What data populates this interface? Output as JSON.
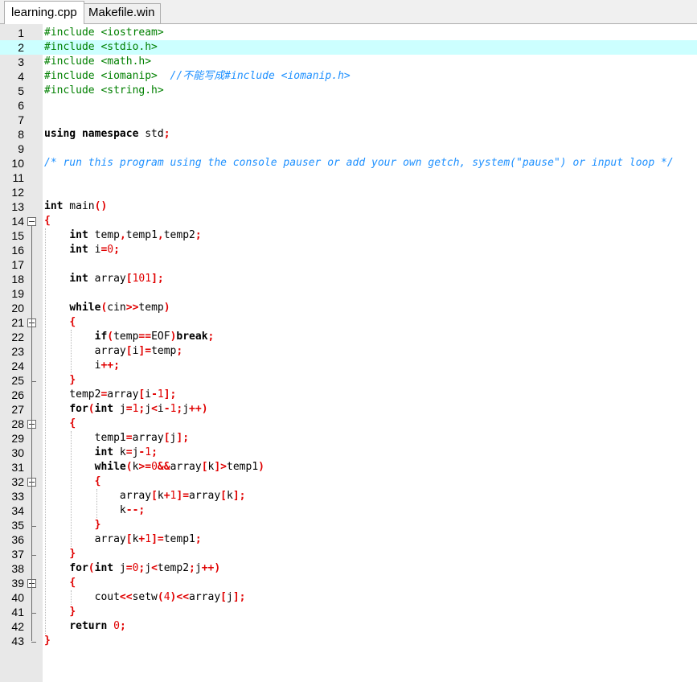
{
  "tabs": [
    "learning.cpp",
    "Makefile.win"
  ],
  "active_tab": 0,
  "highlighted_line": 2,
  "fold_markers": [
    14,
    21,
    28,
    32,
    39
  ],
  "fold_ends": [
    25,
    35,
    37,
    41,
    43
  ],
  "lines": [
    [
      [
        "pp",
        "#include <iostream>"
      ]
    ],
    [
      [
        "pp",
        "#include <stdio.h>"
      ]
    ],
    [
      [
        "pp",
        "#include <math.h>"
      ]
    ],
    [
      [
        "pp",
        "#include <iomanip>"
      ],
      [
        "t",
        "  "
      ],
      [
        "cm",
        "//不能写成#include <iomanip.h>"
      ]
    ],
    [
      [
        "pp",
        "#include <string.h>"
      ]
    ],
    [],
    [],
    [
      [
        "kw",
        "using namespace"
      ],
      [
        "t",
        " std"
      ],
      [
        "sym",
        ";"
      ]
    ],
    [],
    [
      [
        "cm",
        "/* run this program using the console pauser or add your own getch, system(\"pause\") or input loop */"
      ]
    ],
    [],
    [],
    [
      [
        "kw",
        "int"
      ],
      [
        "t",
        " main"
      ],
      [
        "sym",
        "()"
      ]
    ],
    [
      [
        "sym",
        "{"
      ]
    ],
    [
      [
        "t",
        "    "
      ],
      [
        "kw",
        "int"
      ],
      [
        "t",
        " temp"
      ],
      [
        "sym",
        ","
      ],
      [
        "t",
        "temp1"
      ],
      [
        "sym",
        ","
      ],
      [
        "t",
        "temp2"
      ],
      [
        "sym",
        ";"
      ]
    ],
    [
      [
        "t",
        "    "
      ],
      [
        "kw",
        "int"
      ],
      [
        "t",
        " i"
      ],
      [
        "sym",
        "="
      ],
      [
        "num",
        "0"
      ],
      [
        "sym",
        ";"
      ]
    ],
    [],
    [
      [
        "t",
        "    "
      ],
      [
        "kw",
        "int"
      ],
      [
        "t",
        " array"
      ],
      [
        "sym",
        "["
      ],
      [
        "num",
        "101"
      ],
      [
        "sym",
        "];"
      ]
    ],
    [],
    [
      [
        "t",
        "    "
      ],
      [
        "kw",
        "while"
      ],
      [
        "sym",
        "("
      ],
      [
        "t",
        "cin"
      ],
      [
        "sym",
        ">>"
      ],
      [
        "t",
        "temp"
      ],
      [
        "sym",
        ")"
      ]
    ],
    [
      [
        "t",
        "    "
      ],
      [
        "sym",
        "{"
      ]
    ],
    [
      [
        "t",
        "        "
      ],
      [
        "kw",
        "if"
      ],
      [
        "sym",
        "("
      ],
      [
        "t",
        "temp"
      ],
      [
        "sym",
        "=="
      ],
      [
        "t",
        "EOF"
      ],
      [
        "sym",
        ")"
      ],
      [
        "kw",
        "break"
      ],
      [
        "sym",
        ";"
      ]
    ],
    [
      [
        "t",
        "        array"
      ],
      [
        "sym",
        "["
      ],
      [
        "t",
        "i"
      ],
      [
        "sym",
        "]="
      ],
      [
        "t",
        "temp"
      ],
      [
        "sym",
        ";"
      ]
    ],
    [
      [
        "t",
        "        i"
      ],
      [
        "sym",
        "++;"
      ]
    ],
    [
      [
        "t",
        "    "
      ],
      [
        "sym",
        "}"
      ]
    ],
    [
      [
        "t",
        "    temp2"
      ],
      [
        "sym",
        "="
      ],
      [
        "t",
        "array"
      ],
      [
        "sym",
        "["
      ],
      [
        "t",
        "i"
      ],
      [
        "sym",
        "-"
      ],
      [
        "num",
        "1"
      ],
      [
        "sym",
        "];"
      ]
    ],
    [
      [
        "t",
        "    "
      ],
      [
        "kw",
        "for"
      ],
      [
        "sym",
        "("
      ],
      [
        "kw",
        "int"
      ],
      [
        "t",
        " j"
      ],
      [
        "sym",
        "="
      ],
      [
        "num",
        "1"
      ],
      [
        "sym",
        ";"
      ],
      [
        "t",
        "j"
      ],
      [
        "sym",
        "<"
      ],
      [
        "t",
        "i"
      ],
      [
        "sym",
        "-"
      ],
      [
        "num",
        "1"
      ],
      [
        "sym",
        ";"
      ],
      [
        "t",
        "j"
      ],
      [
        "sym",
        "++)"
      ]
    ],
    [
      [
        "t",
        "    "
      ],
      [
        "sym",
        "{"
      ]
    ],
    [
      [
        "t",
        "        temp1"
      ],
      [
        "sym",
        "="
      ],
      [
        "t",
        "array"
      ],
      [
        "sym",
        "["
      ],
      [
        "t",
        "j"
      ],
      [
        "sym",
        "];"
      ]
    ],
    [
      [
        "t",
        "        "
      ],
      [
        "kw",
        "int"
      ],
      [
        "t",
        " k"
      ],
      [
        "sym",
        "="
      ],
      [
        "t",
        "j"
      ],
      [
        "sym",
        "-"
      ],
      [
        "num",
        "1"
      ],
      [
        "sym",
        ";"
      ]
    ],
    [
      [
        "t",
        "        "
      ],
      [
        "kw",
        "while"
      ],
      [
        "sym",
        "("
      ],
      [
        "t",
        "k"
      ],
      [
        "sym",
        ">="
      ],
      [
        "num",
        "0"
      ],
      [
        "sym",
        "&&"
      ],
      [
        "t",
        "array"
      ],
      [
        "sym",
        "["
      ],
      [
        "t",
        "k"
      ],
      [
        "sym",
        "]>"
      ],
      [
        "t",
        "temp1"
      ],
      [
        "sym",
        ")"
      ]
    ],
    [
      [
        "t",
        "        "
      ],
      [
        "sym",
        "{"
      ]
    ],
    [
      [
        "t",
        "            array"
      ],
      [
        "sym",
        "["
      ],
      [
        "t",
        "k"
      ],
      [
        "sym",
        "+"
      ],
      [
        "num",
        "1"
      ],
      [
        "sym",
        "]="
      ],
      [
        "t",
        "array"
      ],
      [
        "sym",
        "["
      ],
      [
        "t",
        "k"
      ],
      [
        "sym",
        "];"
      ]
    ],
    [
      [
        "t",
        "            k"
      ],
      [
        "sym",
        "--;"
      ]
    ],
    [
      [
        "t",
        "        "
      ],
      [
        "sym",
        "}"
      ]
    ],
    [
      [
        "t",
        "        array"
      ],
      [
        "sym",
        "["
      ],
      [
        "t",
        "k"
      ],
      [
        "sym",
        "+"
      ],
      [
        "num",
        "1"
      ],
      [
        "sym",
        "]="
      ],
      [
        "t",
        "temp1"
      ],
      [
        "sym",
        ";"
      ]
    ],
    [
      [
        "t",
        "    "
      ],
      [
        "sym",
        "}"
      ]
    ],
    [
      [
        "t",
        "    "
      ],
      [
        "kw",
        "for"
      ],
      [
        "sym",
        "("
      ],
      [
        "kw",
        "int"
      ],
      [
        "t",
        " j"
      ],
      [
        "sym",
        "="
      ],
      [
        "num",
        "0"
      ],
      [
        "sym",
        ";"
      ],
      [
        "t",
        "j"
      ],
      [
        "sym",
        "<"
      ],
      [
        "t",
        "temp2"
      ],
      [
        "sym",
        ";"
      ],
      [
        "t",
        "j"
      ],
      [
        "sym",
        "++)"
      ]
    ],
    [
      [
        "t",
        "    "
      ],
      [
        "sym",
        "{"
      ]
    ],
    [
      [
        "t",
        "        cout"
      ],
      [
        "sym",
        "<<"
      ],
      [
        "t",
        "setw"
      ],
      [
        "sym",
        "("
      ],
      [
        "num",
        "4"
      ],
      [
        "sym",
        ")<<"
      ],
      [
        "t",
        "array"
      ],
      [
        "sym",
        "["
      ],
      [
        "t",
        "j"
      ],
      [
        "sym",
        "];"
      ]
    ],
    [
      [
        "t",
        "    "
      ],
      [
        "sym",
        "}"
      ]
    ],
    [
      [
        "t",
        "    "
      ],
      [
        "kw",
        "return"
      ],
      [
        "t",
        " "
      ],
      [
        "num",
        "0"
      ],
      [
        "sym",
        ";"
      ]
    ],
    [
      [
        "sym",
        "}"
      ]
    ]
  ]
}
